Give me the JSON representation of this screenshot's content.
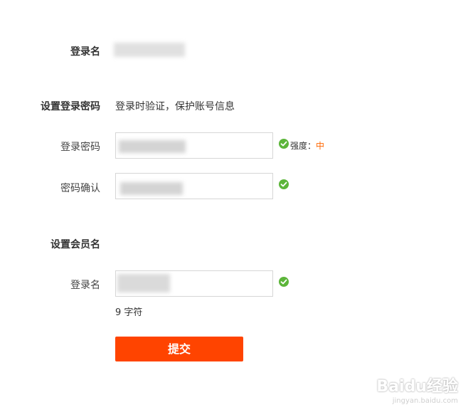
{
  "account": {
    "login_name_label": "登录名"
  },
  "password_section": {
    "heading": "设置登录密码",
    "description": "登录时验证，保护账号信息",
    "password_label": "登录密码",
    "confirm_label": "密码确认",
    "strength_label": "强度：",
    "strength_value": "中"
  },
  "member_section": {
    "heading": "设置会员名",
    "login_name_label": "登录名",
    "char_count": "9 字符"
  },
  "submit_label": "提交",
  "watermark": {
    "logo_text": "Baidu经验",
    "url": "jingyan.baidu.com"
  },
  "colors": {
    "accent": "#ff4400",
    "strength_medium": "#ff6600",
    "valid_check": "#5cb53a"
  }
}
